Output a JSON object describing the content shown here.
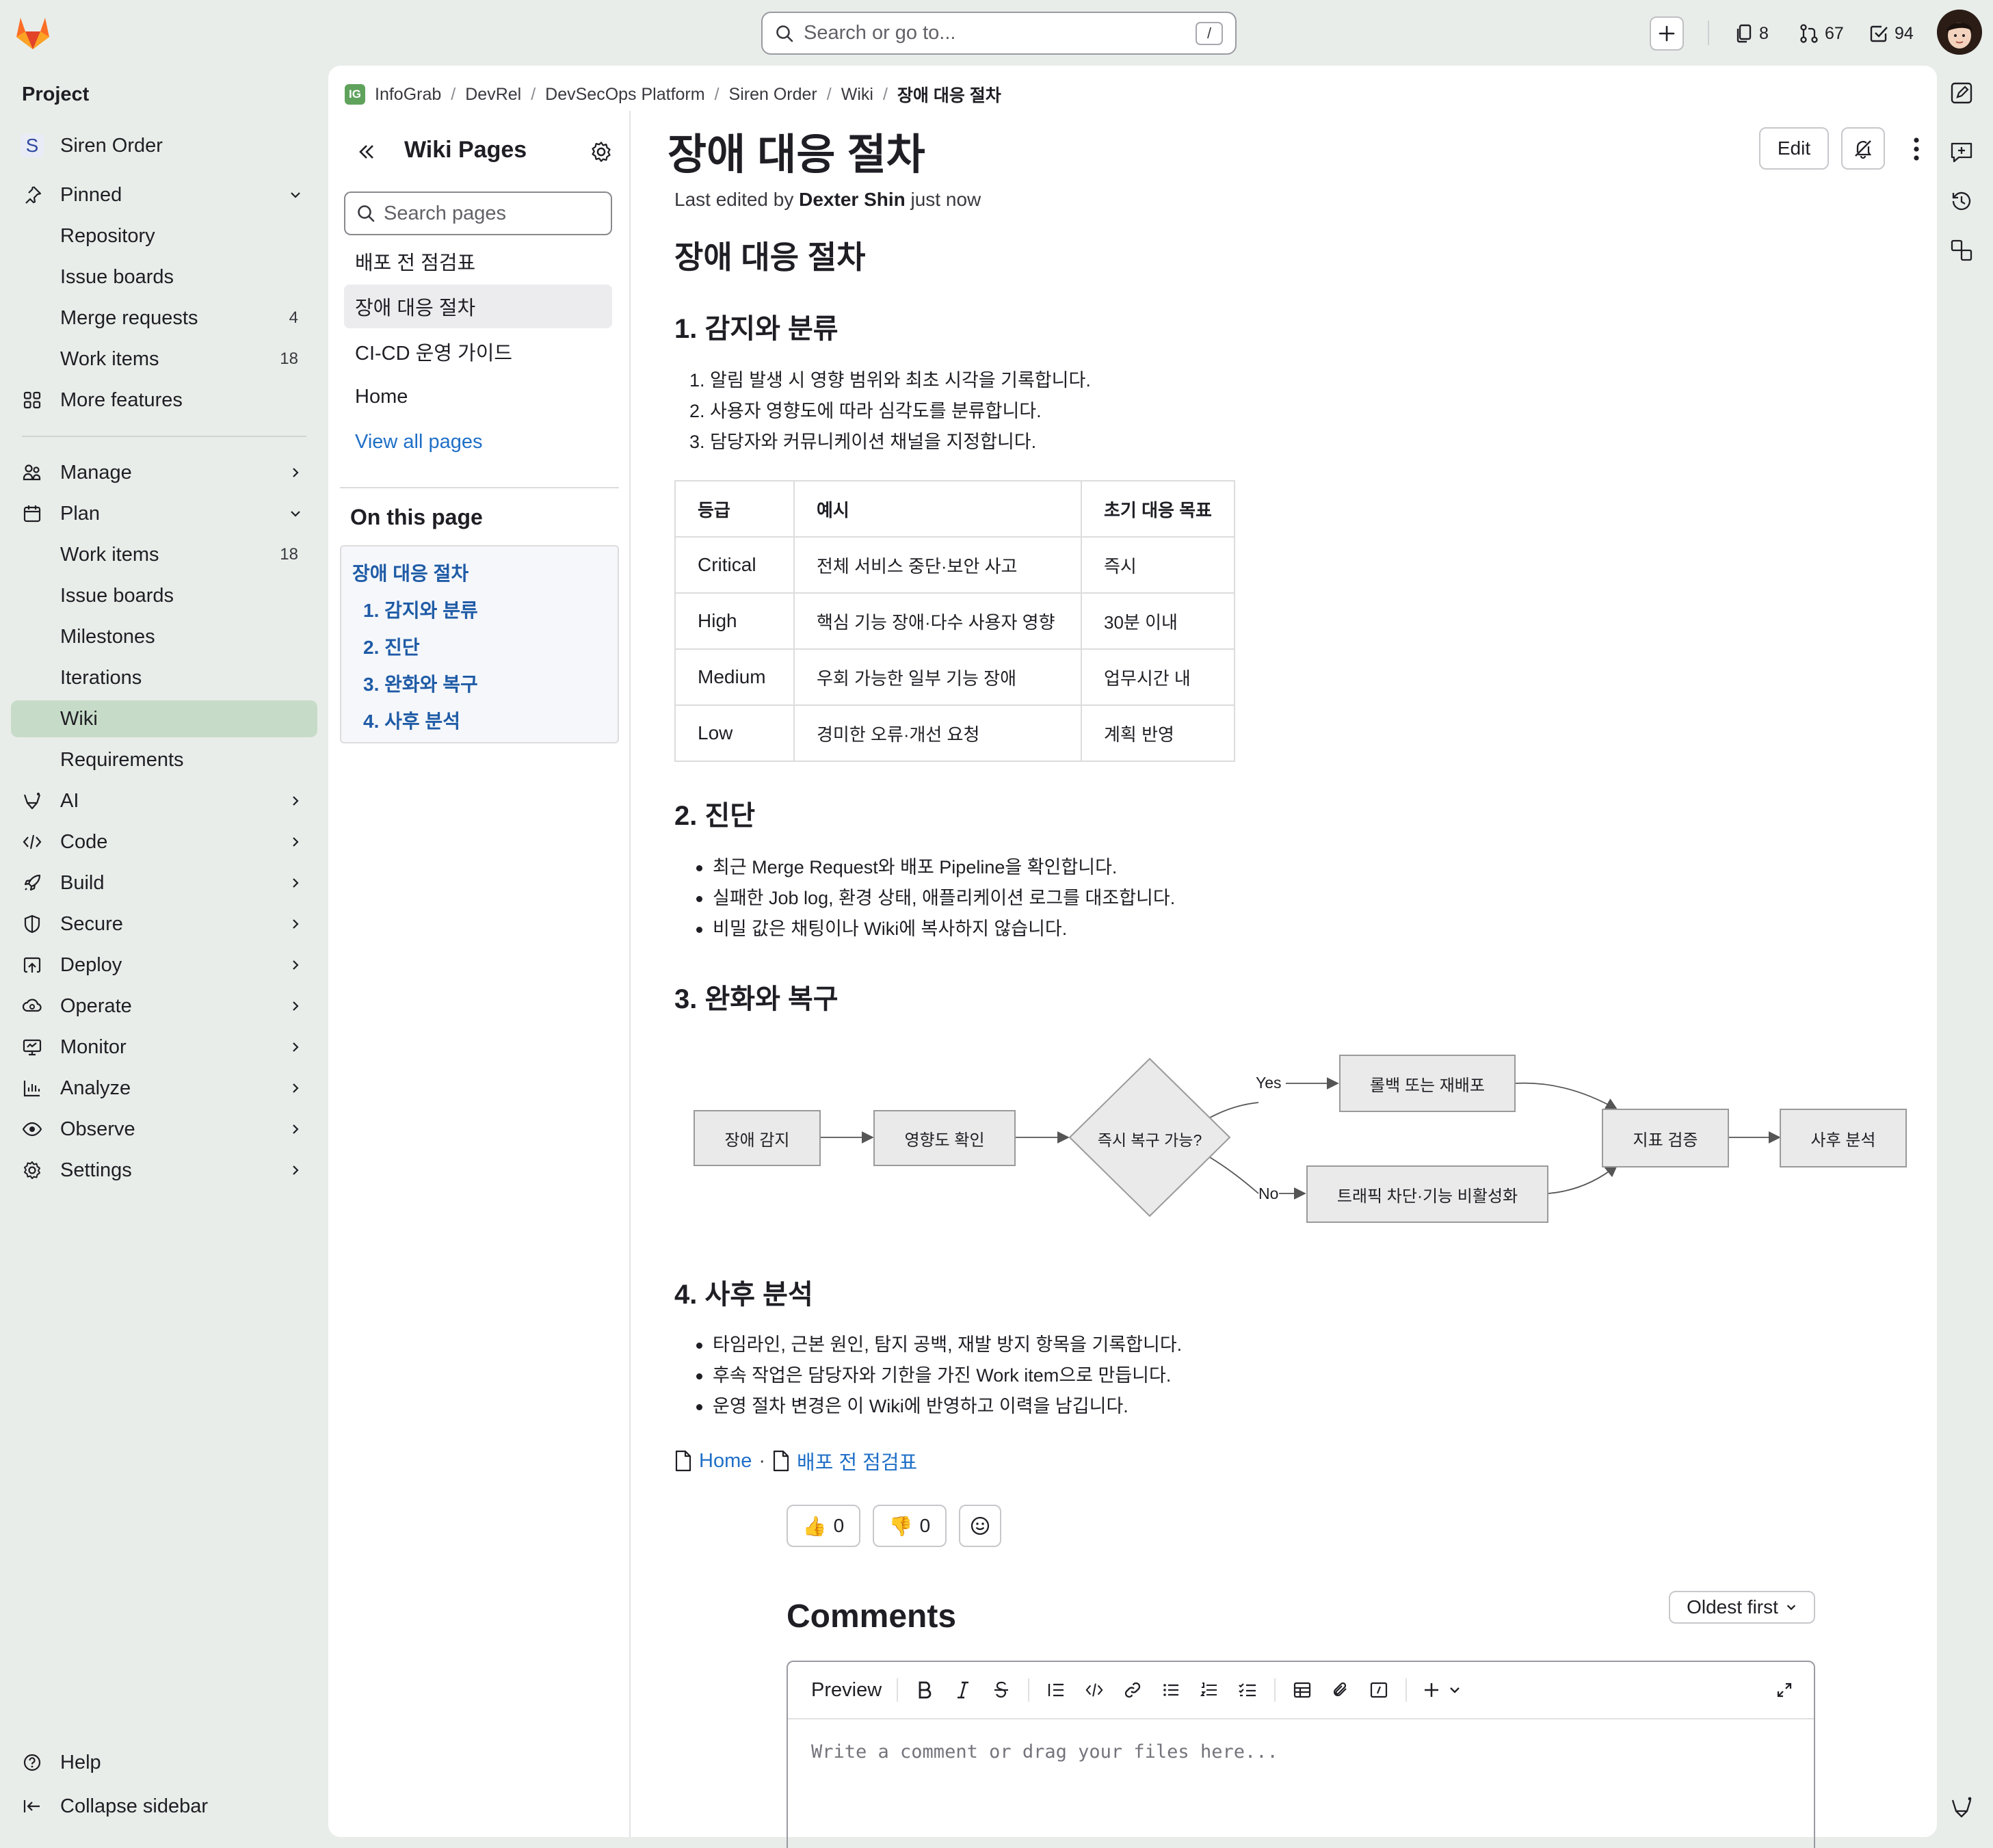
{
  "topbar": {
    "search_placeholder": "Search or go to...",
    "search_shortcut": "/",
    "counters": {
      "issues": "8",
      "merge_requests": "67",
      "todos": "94"
    }
  },
  "sidebar": {
    "section_title": "Project",
    "project": {
      "initial": "S",
      "name": "Siren Order"
    },
    "pinned_label": "Pinned",
    "pinned_items": [
      {
        "label": "Repository",
        "count": ""
      },
      {
        "label": "Issue boards",
        "count": ""
      },
      {
        "label": "Merge requests",
        "count": "4"
      },
      {
        "label": "Work items",
        "count": "18"
      }
    ],
    "more_features": "More features",
    "groups": {
      "manage": "Manage",
      "plan": "Plan",
      "ai": "AI",
      "code": "Code",
      "build": "Build",
      "secure": "Secure",
      "deploy": "Deploy",
      "operate": "Operate",
      "monitor": "Monitor",
      "analyze": "Analyze",
      "observe": "Observe",
      "settings": "Settings"
    },
    "plan_items": [
      {
        "label": "Work items",
        "count": "18"
      },
      {
        "label": "Issue boards",
        "count": ""
      },
      {
        "label": "Milestones",
        "count": ""
      },
      {
        "label": "Iterations",
        "count": ""
      },
      {
        "label": "Wiki",
        "count": ""
      },
      {
        "label": "Requirements",
        "count": ""
      }
    ],
    "help": "Help",
    "collapse": "Collapse sidebar"
  },
  "breadcrumb": {
    "group_badge": "IG",
    "items": [
      "InfoGrab",
      "DevRel",
      "DevSecOps Platform",
      "Siren Order",
      "Wiki",
      "장애 대응 절차"
    ]
  },
  "wiki_sidebar": {
    "title": "Wiki Pages",
    "search_placeholder": "Search pages",
    "pages": [
      "배포 전 점검표",
      "장애 대응 절차",
      "CI-CD 운영 가이드",
      "Home"
    ],
    "view_all": "View all pages",
    "on_this_page": "On this page",
    "toc": [
      "장애 대응 절차",
      "1. 감지와 분류",
      "2. 진단",
      "3. 완화와 복구",
      "4. 사후 분석"
    ]
  },
  "page": {
    "title": "장애 대응 절차",
    "edit_label": "Edit",
    "meta_prefix": "Last edited by",
    "meta_author": "Dexter Shin",
    "meta_suffix": "just now",
    "h1": "장애 대응 절차",
    "section1": {
      "heading": "1. 감지와 분류",
      "items": [
        "1. 알림 발생 시 영향 범위와 최초 시각을 기록합니다.",
        "2. 사용자 영향도에 따라 심각도를 분류합니다.",
        "3. 담당자와 커뮤니케이션 채널을 지정합니다."
      ]
    },
    "table": {
      "headers": [
        "등급",
        "예시",
        "초기 대응 목표"
      ],
      "rows": [
        [
          "Critical",
          "전체 서비스 중단·보안 사고",
          "즉시"
        ],
        [
          "High",
          "핵심 기능 장애·다수 사용자 영향",
          "30분 이내"
        ],
        [
          "Medium",
          "우회 가능한 일부 기능 장애",
          "업무시간 내"
        ],
        [
          "Low",
          "경미한 오류·개선 요청",
          "계획 반영"
        ]
      ]
    },
    "section2": {
      "heading": "2. 진단",
      "items": [
        "최근 Merge Request와 배포 Pipeline을 확인합니다.",
        "실패한 Job log, 환경 상태, 애플리케이션 로그를 대조합니다.",
        "비밀 값은 채팅이나 Wiki에 복사하지 않습니다."
      ]
    },
    "section3": {
      "heading": "3. 완화와 복구",
      "flow": {
        "detect": "장애 감지",
        "impact": "영향도 확인",
        "decision": "즉시 복구 가능?",
        "rollback": "롤백 또는 재배포",
        "block": "트래픽 차단·기능 비활성화",
        "verify": "지표 검증",
        "postmortem": "사후 분석",
        "yes": "Yes",
        "no": "No"
      }
    },
    "section4": {
      "heading": "4. 사후 분석",
      "items": [
        "타임라인, 근본 원인, 탐지 공백, 재발 방지 항목을 기록합니다.",
        "후속 작업은 담당자와 기한을 가진 Work item으로 만듭니다.",
        "운영 절차 변경은 이 Wiki에 반영하고 이력을 남깁니다."
      ]
    },
    "page_links": [
      "Home",
      "배포 전 점검표"
    ],
    "page_links_sep": "·",
    "reactions": {
      "thumbs_up": "0",
      "thumbs_down": "0"
    }
  },
  "comments": {
    "title": "Comments",
    "sort": "Oldest first",
    "preview": "Preview",
    "placeholder": "Write a comment or drag your files here..."
  }
}
